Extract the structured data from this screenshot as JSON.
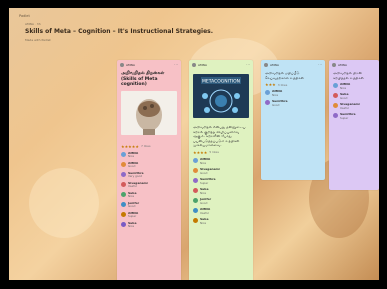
{
  "board": {
    "top_link": "Padlet",
    "author": "AMNA · 3h",
    "title": "Skills of Meta – Cognition – It's Instructional Strategies.",
    "subtitle": "Made with Padlet"
  },
  "columns": [
    {
      "color": "#f7c1c6",
      "header_name": "AMNA",
      "post_title": "அறிவறிதல் திறன்கள் (Skills of Meta cognition)",
      "rating_stars": "★★★★★",
      "rating_count": "7 likes",
      "comments": [
        {
          "name": "AMNA",
          "text": "Nice",
          "color": "#6aa0d6"
        },
        {
          "name": "AMNA",
          "text": "Good",
          "color": "#e08c3a"
        },
        {
          "name": "Sumithra",
          "text": "Very good",
          "color": "#8f6ac7"
        },
        {
          "name": "Sivaganami",
          "text": "Useful",
          "color": "#d35b5b"
        },
        {
          "name": "Suba",
          "text": "Nice",
          "color": "#4ca36b"
        },
        {
          "name": "Jenifer",
          "text": "Good",
          "color": "#3f8fc4"
        },
        {
          "name": "AMNA",
          "text": "Super",
          "color": "#c47a00"
        },
        {
          "name": "Suba",
          "text": "Nice",
          "color": "#7a5bc4"
        }
      ]
    },
    {
      "color": "#dff2c0",
      "header_name": "AMNA",
      "image_label": "METACOGNITION",
      "post_text": "அறிவறிதல் என்பது தன்னுடைய கற்றல் குறித்த விழிப்புணர்வு ஆகும். கற்றலின் போது பயன்படுத்தப்படும் உத்திகள் முக்கியமானவை.",
      "rating_stars": "★★★★",
      "rating_count": "5 likes",
      "comments": [
        {
          "name": "AMNA",
          "text": "Nice",
          "color": "#6aa0d6"
        },
        {
          "name": "Sivaganami",
          "text": "Good",
          "color": "#e08c3a"
        },
        {
          "name": "Sumithra",
          "text": "Super",
          "color": "#8f6ac7"
        },
        {
          "name": "Suba",
          "text": "Nice",
          "color": "#d35b5b"
        },
        {
          "name": "Jenifer",
          "text": "Good",
          "color": "#4ca36b"
        },
        {
          "name": "AMNA",
          "text": "Useful",
          "color": "#3f8fc4"
        },
        {
          "name": "Suba",
          "text": "Nice",
          "color": "#c47a00"
        }
      ]
    },
    {
      "color": "#bfe3f5",
      "header_name": "AMNA",
      "post_text": "அறிவறிதல் மதிப்பீடு செய்வதற்கான உத்திகள்",
      "rating_stars": "★★★",
      "rating_count": "3 likes",
      "comments": [
        {
          "name": "AMNA",
          "text": "Nice",
          "color": "#6aa0d6"
        },
        {
          "name": "Sumithra",
          "text": "Good",
          "color": "#8f6ac7"
        }
      ]
    },
    {
      "color": "#dcc8f4",
      "header_name": "AMNA",
      "post_text": "அறிவறிதல் திறன் கற்பித்தல் உத்திகள்",
      "rating_stars": "",
      "rating_count": "",
      "comments": [
        {
          "name": "AMNA",
          "text": "Nice",
          "color": "#6aa0d6"
        },
        {
          "name": "Suba",
          "text": "Good",
          "color": "#d35b5b"
        },
        {
          "name": "Sivaganami",
          "text": "Useful",
          "color": "#e08c3a"
        },
        {
          "name": "Sumithra",
          "text": "Super",
          "color": "#8f6ac7"
        }
      ]
    }
  ]
}
